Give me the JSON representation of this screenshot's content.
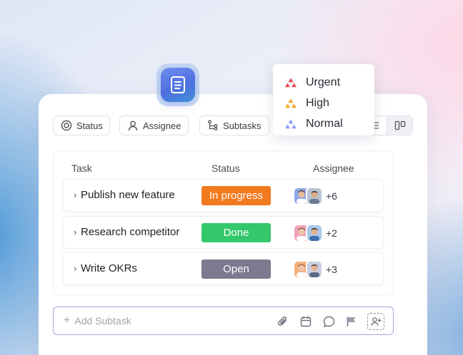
{
  "filters": [
    {
      "label": "Status",
      "icon": "status-icon"
    },
    {
      "label": "Assignee",
      "icon": "user-icon"
    },
    {
      "label": "Subtasks",
      "icon": "subtasks-icon"
    }
  ],
  "priority_menu": {
    "items": [
      {
        "label": "Urgent",
        "icon": "priority-urgent-icon",
        "color": "#e5484d"
      },
      {
        "label": "High",
        "icon": "priority-high-icon",
        "color": "#f5a524"
      },
      {
        "label": "Normal",
        "icon": "priority-normal-icon",
        "color": "#8e9ef0"
      }
    ]
  },
  "table": {
    "headers": {
      "task": "Task",
      "status": "Status",
      "assignee": "Assignee"
    },
    "rows": [
      {
        "task": "Publish new feature",
        "status": "In progress",
        "status_color": "#f27a1e",
        "assignee_extra": "+6"
      },
      {
        "task": "Research competitor",
        "status": "Done",
        "status_color": "#34c76b",
        "assignee_extra": "+2"
      },
      {
        "task": "Write OKRs",
        "status": "Open",
        "status_color": "#7b7a8e",
        "assignee_extra": "+3"
      }
    ]
  },
  "subtask": {
    "plus": "+",
    "placeholder": "Add Subtask"
  }
}
